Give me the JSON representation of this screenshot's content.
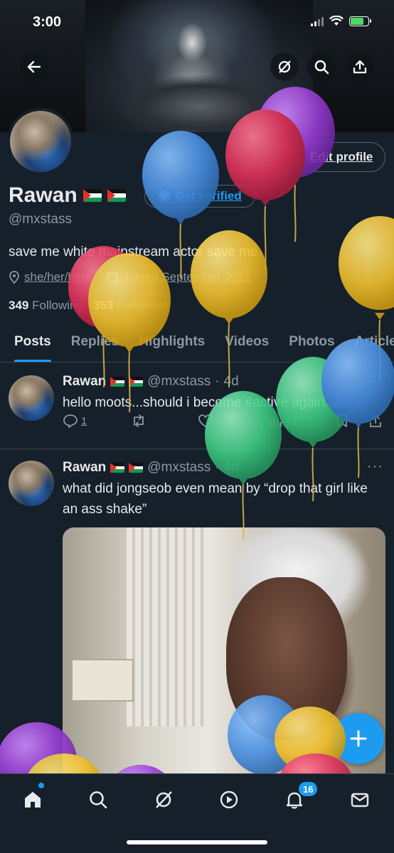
{
  "status_bar": {
    "time": "3:00"
  },
  "header": {
    "back_icon": "arrow-left-icon",
    "grok_icon": "grok-icon",
    "search_icon": "search-icon",
    "share_icon": "share-icon"
  },
  "profile": {
    "display_name": "Rawan",
    "handle": "@mxstass",
    "edit_label": "Edit profile",
    "verify_label": "Get verified",
    "bio": "save me white mainstream actor save me",
    "pronouns": "she/her/hers",
    "joined": "Joined September 2021",
    "following_count": "349",
    "following_label": "Following",
    "followers_count": "353",
    "followers_label": "Followers"
  },
  "tabs": [
    "Posts",
    "Replies",
    "Highlights",
    "Videos",
    "Photos",
    "Articles"
  ],
  "active_tab": "Posts",
  "tweets": [
    {
      "name": "Rawan",
      "handle": "@mxstass",
      "time": "4d",
      "text": "hello moots...should i become #active again....",
      "replies": "1",
      "views": "41"
    },
    {
      "name": "Rawan",
      "handle": "@mxstass",
      "time": "4d",
      "text": "what did jongseob even mean by “drop that girl like an ass shake”",
      "media": "photo"
    }
  ],
  "nav": {
    "notifications_badge": "16",
    "compose_icon": "plus-icon"
  },
  "colors": {
    "background": "#15202b",
    "accent": "#1d9bf0",
    "muted": "#8b98a5",
    "text": "#e7e9ea",
    "balloons": [
      "#4a90e2",
      "#e0325a",
      "#9b3fd6",
      "#f2c230",
      "#3fcc85"
    ]
  }
}
